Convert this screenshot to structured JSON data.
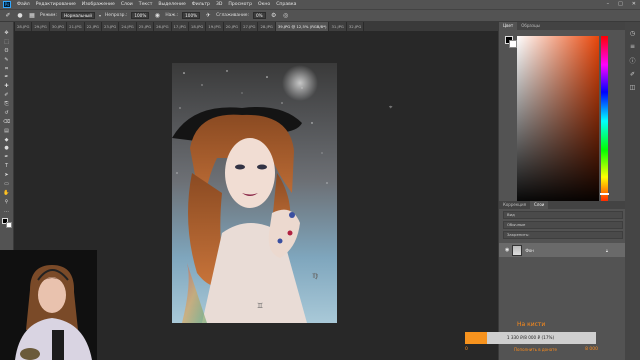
{
  "app": {
    "logo_text": "Ps",
    "menu": [
      "Файл",
      "Редактирование",
      "Изображение",
      "Слои",
      "Текст",
      "Выделение",
      "Фильтр",
      "3D",
      "Просмотр",
      "Окно",
      "Справка"
    ],
    "window_controls": [
      "–",
      "□",
      "✕"
    ]
  },
  "options": {
    "mode_label": "Режим:",
    "mode_value": "Нормальный",
    "opacity_label": "Непрозр.:",
    "opacity_value": "100%",
    "flow_label": "Наж.:",
    "flow_value": "100%",
    "smoothing_label": "Сглаживание:",
    "smoothing_value": "0%"
  },
  "tabs": [
    {
      "label": "28.JPG",
      "active": false
    },
    {
      "label": "29.JPG",
      "active": false
    },
    {
      "label": "30.JPG",
      "active": false
    },
    {
      "label": "21.JPG",
      "active": false
    },
    {
      "label": "22.JPG",
      "active": false
    },
    {
      "label": "23.JPG",
      "active": false
    },
    {
      "label": "24.JPG",
      "active": false
    },
    {
      "label": "25.JPG",
      "active": false
    },
    {
      "label": "26.JPG",
      "active": false
    },
    {
      "label": "17.JPG",
      "active": false
    },
    {
      "label": "18.JPG",
      "active": false
    },
    {
      "label": "19.JPG",
      "active": false
    },
    {
      "label": "20.JPG",
      "active": false
    },
    {
      "label": "27.JPG",
      "active": false
    },
    {
      "label": "28.JPG",
      "active": false
    },
    {
      "label": "39.JPG @ 12,5% (RGB/8*)",
      "active": true
    },
    {
      "label": "31.JPG",
      "active": false
    },
    {
      "label": "32.JPG",
      "active": false
    }
  ],
  "tools": [
    "move-tool",
    "marquee-tool",
    "lasso-tool",
    "quick-select-tool",
    "crop-tool",
    "eyedropper-tool",
    "healing-tool",
    "brush-tool",
    "clone-stamp-tool",
    "history-brush-tool",
    "eraser-tool",
    "gradient-tool",
    "blur-tool",
    "dodge-tool",
    "pen-tool",
    "type-tool",
    "path-select-tool",
    "shape-tool",
    "hand-tool",
    "zoom-tool",
    "more-tools"
  ],
  "tool_glyphs": [
    "✥",
    "⬚",
    "ʘ",
    "✎",
    "⌗",
    "✒",
    "✚",
    "✐",
    "⎘",
    "↺",
    "⌫",
    "▤",
    "◆",
    "●",
    "✒",
    "T",
    "➤",
    "▭",
    "✋",
    "⚲",
    "…"
  ],
  "panels": {
    "color_tabs": [
      "Цвет",
      "Образцы"
    ],
    "layers_tabs": [
      "Коррекция",
      "Слои"
    ],
    "layer_rows": [
      "Вид",
      "Обычные",
      "Закрепить:"
    ],
    "layer_name": "Фон",
    "hue_marker": 0.93
  },
  "side_strip_icons": [
    "history-icon",
    "properties-icon",
    "info-icon",
    "brush-settings-icon",
    "channels-icon"
  ],
  "side_strip_glyphs": [
    "◷",
    "≡",
    "ⓘ",
    "✐",
    "◫"
  ],
  "goal": {
    "title": "На кисти",
    "amount": "1 330 ₽/8 000 ₽ (17%)",
    "progress": 0.17,
    "start": "0",
    "caption": "Пополнить в донате",
    "end": "8 000"
  },
  "colors": {
    "accent": "#ff8c1a",
    "progress": "#f7931e",
    "ui_bg": "#535353",
    "canvas_bg": "#282828"
  }
}
